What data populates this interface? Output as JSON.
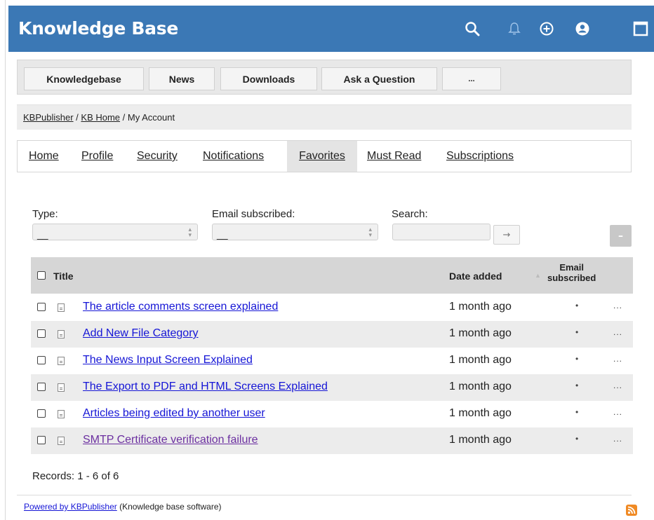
{
  "header": {
    "title": "Knowledge Base",
    "bg_color": "#3b78b5",
    "icons": [
      "search-icon",
      "bell-icon",
      "add-circle-icon",
      "user-icon",
      "window-icon"
    ]
  },
  "menu": {
    "items": [
      "Knowledgebase",
      "News",
      "Downloads",
      "Ask a Question",
      "..."
    ]
  },
  "breadcrumb": {
    "items": [
      "KBPublisher",
      "KB Home",
      "My Account"
    ],
    "separator": "/"
  },
  "tabs": {
    "items": [
      "Home",
      "Profile",
      "Security",
      "Notifications",
      "Favorites",
      "Must Read",
      "Subscriptions"
    ],
    "active": "Favorites"
  },
  "filters": {
    "type_label": "Type:",
    "type_value": "__",
    "email_label": "Email subscribed:",
    "email_value": "__",
    "search_label": "Search:",
    "search_value": "",
    "go_label": "→",
    "collapse_label": "–"
  },
  "table": {
    "headers": {
      "title": "Title",
      "date": "Date added",
      "email_line1": "Email",
      "email_line2": "subscribed"
    },
    "rows": [
      {
        "title": "The article comments screen explained",
        "date": "1 month ago",
        "email": "•",
        "more": "..."
      },
      {
        "title": "Add New File Category",
        "date": "1 month ago",
        "email": "•",
        "more": "..."
      },
      {
        "title": "The News Input Screen Explained",
        "date": "1 month ago",
        "email": "•",
        "more": "..."
      },
      {
        "title": "The Export to PDF and HTML Screens Explained",
        "date": "1 month ago",
        "email": "•",
        "more": "..."
      },
      {
        "title": "Articles being edited by another user",
        "date": "1 month ago",
        "email": "•",
        "more": "..."
      },
      {
        "title": "SMTP Certificate verification failure",
        "date": "1 month ago",
        "email": "•",
        "more": "..."
      }
    ]
  },
  "records": "Records: 1 - 6 of 6",
  "footer": {
    "link": "Powered by KBPublisher",
    "text": " (Knowledge base software)"
  }
}
